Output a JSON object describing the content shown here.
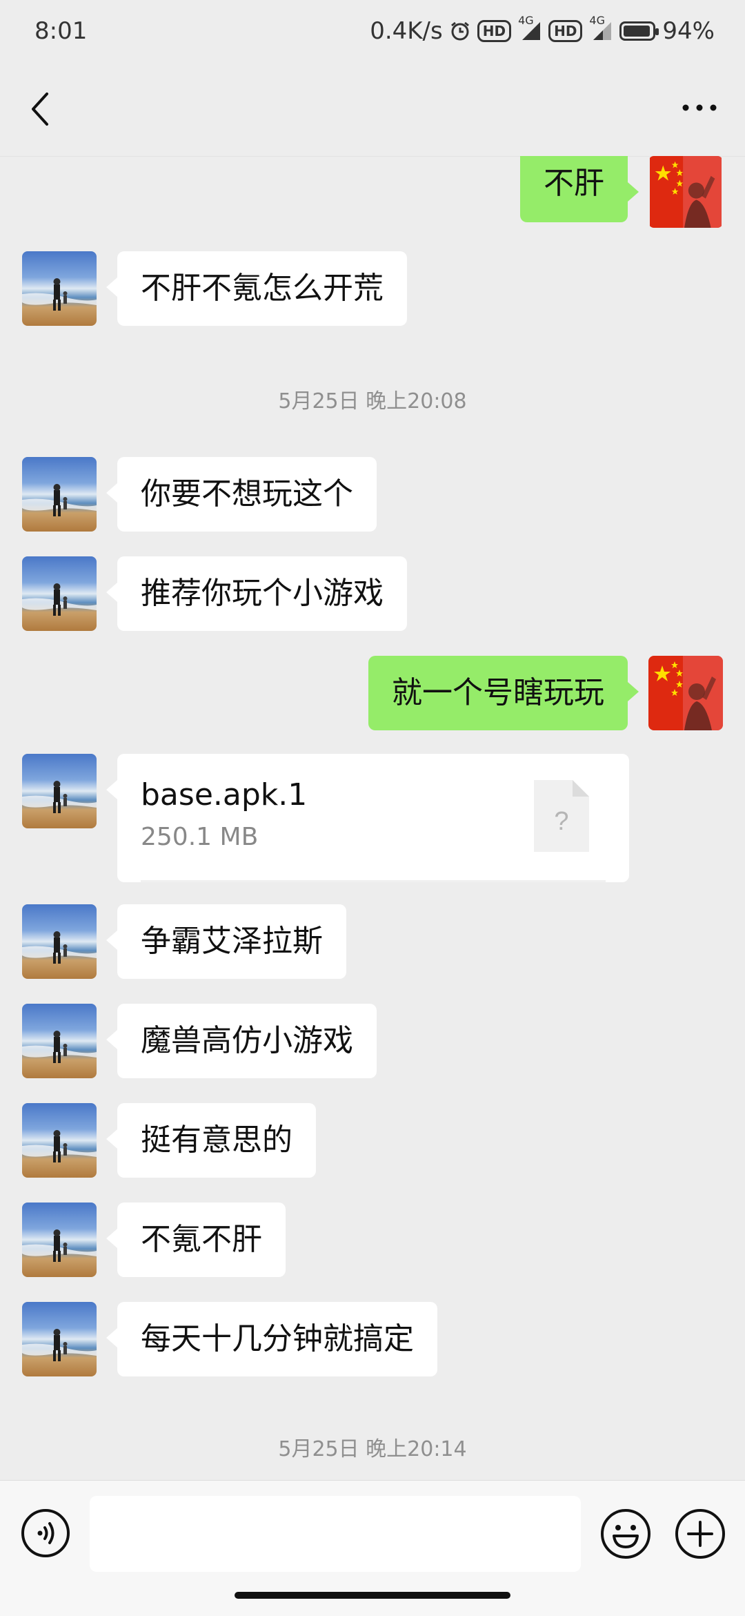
{
  "status_bar": {
    "time": "8:01",
    "net_speed": "0.4K/s",
    "hd_1": "HD",
    "net_type_1": "4G",
    "hd_2": "HD",
    "net_type_2": "4G",
    "battery": "94%",
    "battery_level": 0.94,
    "icons": [
      "alarm-icon",
      "signal-icon",
      "battery-icon"
    ]
  },
  "nav": {
    "back_icon": "chevron-left-icon",
    "more_icon": "more-icon"
  },
  "messages": [
    {
      "direction": "out",
      "text": "不肝"
    },
    {
      "direction": "in",
      "text": "不肝不氪怎么开荒"
    },
    {
      "direction": "in",
      "text": "你要不想玩这个"
    },
    {
      "direction": "in",
      "text": "推荐你玩个小游戏"
    },
    {
      "direction": "out",
      "text": "就一个号瞎玩玩"
    },
    {
      "direction": "in",
      "type": "file",
      "file_name": "base.apk.1",
      "file_size": "250.1 MB",
      "file_icon_glyph": "?"
    },
    {
      "direction": "in",
      "text": "争霸艾泽拉斯"
    },
    {
      "direction": "in",
      "text": "魔兽高仿小游戏"
    },
    {
      "direction": "in",
      "text": "挺有意思的"
    },
    {
      "direction": "in",
      "text": "不氪不肝"
    },
    {
      "direction": "in",
      "text": "每天十几分钟就搞定"
    }
  ],
  "timestamps": [
    "5月25日 晚上20:08",
    "5月25日 晚上20:14"
  ],
  "input_bar": {
    "placeholder": "",
    "voice_icon": "voice-icon",
    "emoji_icon": "emoji-icon",
    "plus_icon": "plus-icon"
  },
  "colors": {
    "background": "#ededed",
    "outgoing_bubble": "#95ec69",
    "incoming_bubble": "#ffffff",
    "timestamp_text": "#8f8f8f"
  }
}
